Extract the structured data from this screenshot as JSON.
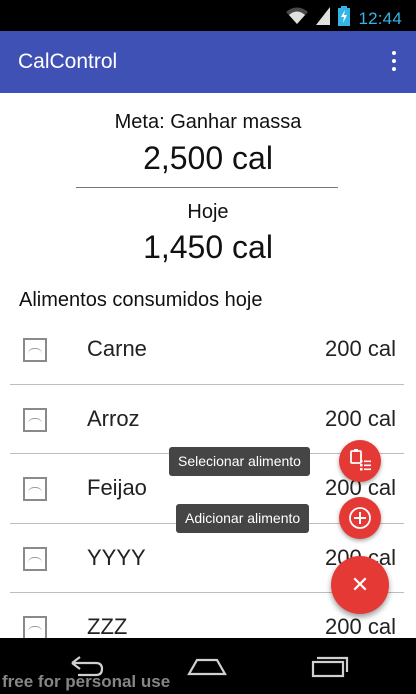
{
  "status_bar": {
    "time": "12:44",
    "icons": [
      "wifi-icon",
      "signal-icon",
      "battery-charging-icon"
    ],
    "time_color": "#33b5e5"
  },
  "app_bar": {
    "title": "CalControl",
    "menu_icon": "overflow-menu-icon",
    "color": "#3f51b5"
  },
  "summary": {
    "goal_label": "Meta: Ganhar massa",
    "goal_value": "2,500 cal",
    "today_label": "Hoje",
    "today_value": "1,450 cal"
  },
  "food_section": {
    "title": "Alimentos consumidos hoje",
    "items": [
      {
        "name": "Carne",
        "calories": "200 cal",
        "icon": "image-placeholder-icon"
      },
      {
        "name": "Arroz",
        "calories": "200 cal",
        "icon": "image-placeholder-icon"
      },
      {
        "name": "Feijao",
        "calories": "200 cal",
        "icon": "image-placeholder-icon"
      },
      {
        "name": "YYYY",
        "calories": "200 cal",
        "icon": "image-placeholder-icon"
      },
      {
        "name": "ZZZ",
        "calories": "200 cal",
        "icon": "image-placeholder-icon"
      }
    ]
  },
  "fab_menu": {
    "select_food_label": "Selecionar alimento",
    "add_food_label": "Adicionar alimento",
    "main_icon": "close-icon",
    "accent_color": "#e53935"
  },
  "nav_bar": {
    "buttons": [
      "back-icon",
      "home-icon",
      "recent-apps-icon"
    ]
  },
  "watermark": "free for personal use"
}
